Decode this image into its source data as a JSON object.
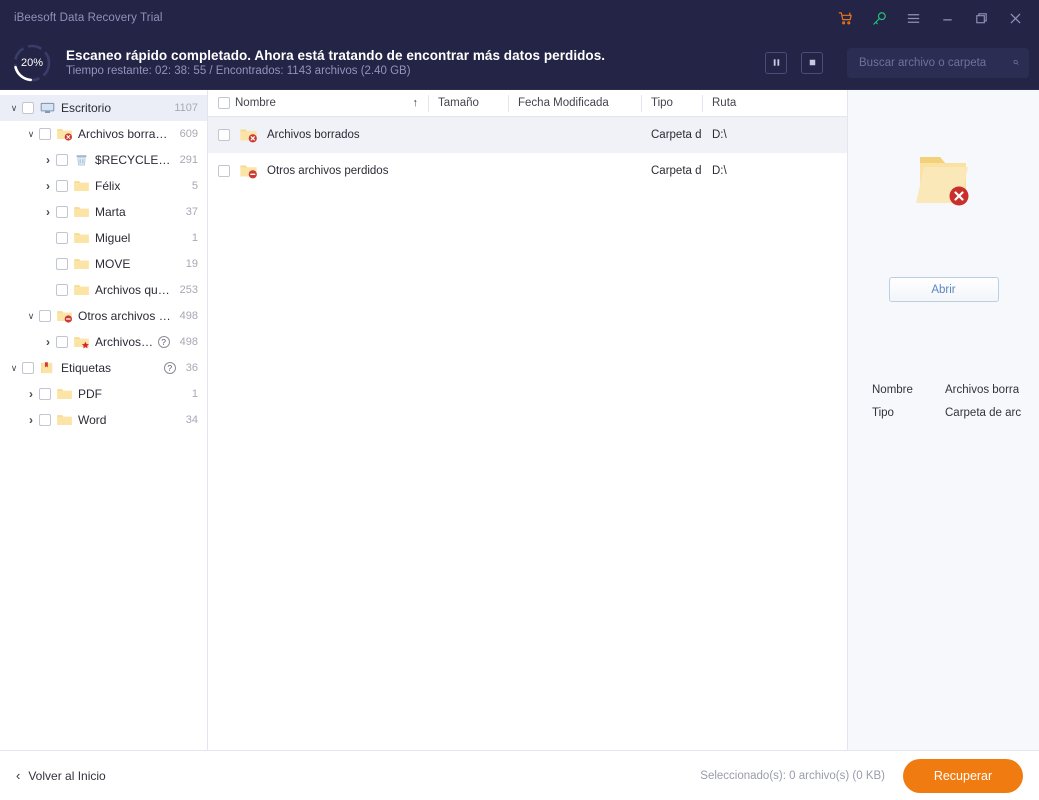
{
  "window": {
    "app_title": "iBeesoft Data Recovery Trial",
    "icons": {
      "cart": "cart-icon",
      "key": "key-icon",
      "menu": "hamburger-menu-icon",
      "minimize": "minimize-icon",
      "maximize": "maximize-icon",
      "close": "close-icon"
    },
    "colors": {
      "titlebar_bg": "#232446",
      "cart": "#e8751a",
      "key": "#22c07c",
      "accent_orange": "#f07c11",
      "selected_row": "#f1f1f8"
    }
  },
  "scan": {
    "progress_percent": 20,
    "progress_label": "20%",
    "title": "Escaneo rápido completado. Ahora está tratando de encontrar más datos perdidos.",
    "subtitle": "Tiempo restante: 02: 38: 55 / Encontrados: 1143 archivos (2.40 GB)",
    "pause_icon": "pause-icon",
    "stop_icon": "stop-icon"
  },
  "search": {
    "placeholder": "Buscar archivo o carpeta",
    "value": "",
    "icon": "search-icon"
  },
  "sidebar": {
    "items": [
      {
        "label": "Escritorio",
        "count": "1107",
        "depth": 0,
        "twisty": "down",
        "icon": "monitor",
        "selected": true,
        "help": false
      },
      {
        "label": "Archivos borrados",
        "count": "609",
        "depth": 1,
        "twisty": "down",
        "icon": "folder-x",
        "selected": false,
        "help": false
      },
      {
        "label": "$RECYCLE.BIN",
        "count": "291",
        "depth": 2,
        "twisty": "right",
        "icon": "recycle-bin",
        "selected": false,
        "help": false
      },
      {
        "label": "Félix",
        "count": "5",
        "depth": 2,
        "twisty": "right",
        "icon": "folder",
        "selected": false,
        "help": false
      },
      {
        "label": "Marta",
        "count": "37",
        "depth": 2,
        "twisty": "right",
        "icon": "folder",
        "selected": false,
        "help": false
      },
      {
        "label": "Miguel",
        "count": "1",
        "depth": 2,
        "twisty": "none",
        "icon": "folder",
        "selected": false,
        "help": false
      },
      {
        "label": "MOVE",
        "count": "19",
        "depth": 2,
        "twisty": "none",
        "icon": "folder",
        "selected": false,
        "help": false
      },
      {
        "label": "Archivos que se han p...",
        "count": "253",
        "depth": 2,
        "twisty": "none",
        "icon": "folder",
        "selected": false,
        "help": false
      },
      {
        "label": "Otros archivos perdidos",
        "count": "498",
        "depth": 1,
        "twisty": "down",
        "icon": "folder-minus",
        "selected": false,
        "help": false
      },
      {
        "label": "Archivos con nom...",
        "count": "498",
        "depth": 2,
        "twisty": "right",
        "icon": "folder-star",
        "selected": false,
        "help": true
      },
      {
        "label": "Etiquetas",
        "count": "36",
        "depth": 0,
        "twisty": "down",
        "icon": "folder-tag",
        "selected": false,
        "help": true
      },
      {
        "label": "PDF",
        "count": "1",
        "depth": 1,
        "twisty": "right",
        "icon": "folder",
        "selected": false,
        "help": false
      },
      {
        "label": "Word",
        "count": "34",
        "depth": 1,
        "twisty": "right",
        "icon": "folder",
        "selected": false,
        "help": false
      }
    ]
  },
  "table": {
    "columns": [
      "Nombre",
      "Tamaño",
      "Fecha Modificada",
      "Tipo",
      "Ruta"
    ],
    "sort": {
      "column": "Nombre",
      "direction": "asc",
      "glyph": "↑"
    },
    "rows": [
      {
        "name": "Archivos borrados",
        "size": "",
        "date": "",
        "type": "Carpeta d...",
        "path": "D:\\",
        "icon": "folder-x",
        "selected": true
      },
      {
        "name": "Otros archivos perdidos",
        "size": "",
        "date": "",
        "type": "Carpeta d...",
        "path": "D:\\",
        "icon": "folder-minus",
        "selected": false
      }
    ]
  },
  "preview": {
    "icon": "folder-x-large",
    "open_label": "Abrir",
    "details": [
      {
        "key": "Nombre",
        "value": "Archivos borra"
      },
      {
        "key": "Tipo",
        "value": "Carpeta de arc"
      }
    ]
  },
  "footer": {
    "back_label": "Volver al Inicio",
    "back_icon": "chevron-left-icon",
    "selection_info": "Seleccionado(s): 0 archivo(s) (0 KB)",
    "recover_label": "Recuperar"
  }
}
